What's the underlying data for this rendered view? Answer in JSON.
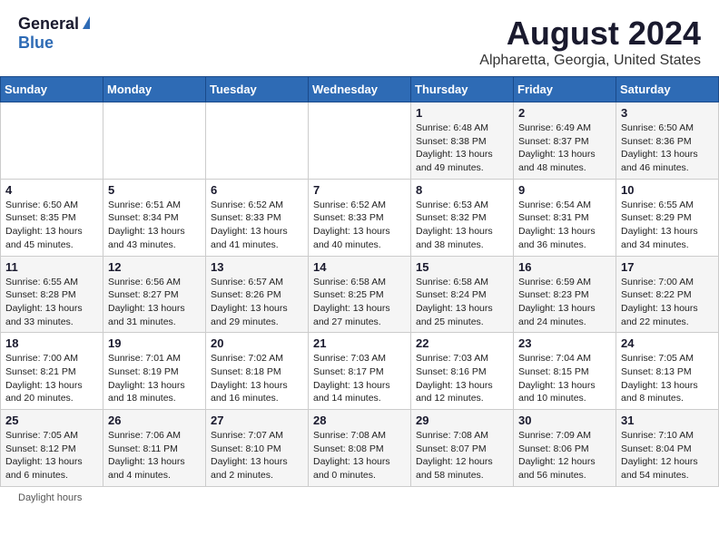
{
  "logo": {
    "general": "General",
    "blue": "Blue"
  },
  "title": "August 2024",
  "subtitle": "Alpharetta, Georgia, United States",
  "days_of_week": [
    "Sunday",
    "Monday",
    "Tuesday",
    "Wednesday",
    "Thursday",
    "Friday",
    "Saturday"
  ],
  "footer": {
    "daylight_label": "Daylight hours"
  },
  "weeks": [
    [
      {
        "day": "",
        "sunrise": "",
        "sunset": "",
        "daylight": "",
        "empty": true
      },
      {
        "day": "",
        "sunrise": "",
        "sunset": "",
        "daylight": "",
        "empty": true
      },
      {
        "day": "",
        "sunrise": "",
        "sunset": "",
        "daylight": "",
        "empty": true
      },
      {
        "day": "",
        "sunrise": "",
        "sunset": "",
        "daylight": "",
        "empty": true
      },
      {
        "day": "1",
        "sunrise": "Sunrise: 6:48 AM",
        "sunset": "Sunset: 8:38 PM",
        "daylight": "Daylight: 13 hours and 49 minutes.",
        "empty": false
      },
      {
        "day": "2",
        "sunrise": "Sunrise: 6:49 AM",
        "sunset": "Sunset: 8:37 PM",
        "daylight": "Daylight: 13 hours and 48 minutes.",
        "empty": false
      },
      {
        "day": "3",
        "sunrise": "Sunrise: 6:50 AM",
        "sunset": "Sunset: 8:36 PM",
        "daylight": "Daylight: 13 hours and 46 minutes.",
        "empty": false
      }
    ],
    [
      {
        "day": "4",
        "sunrise": "Sunrise: 6:50 AM",
        "sunset": "Sunset: 8:35 PM",
        "daylight": "Daylight: 13 hours and 45 minutes.",
        "empty": false
      },
      {
        "day": "5",
        "sunrise": "Sunrise: 6:51 AM",
        "sunset": "Sunset: 8:34 PM",
        "daylight": "Daylight: 13 hours and 43 minutes.",
        "empty": false
      },
      {
        "day": "6",
        "sunrise": "Sunrise: 6:52 AM",
        "sunset": "Sunset: 8:33 PM",
        "daylight": "Daylight: 13 hours and 41 minutes.",
        "empty": false
      },
      {
        "day": "7",
        "sunrise": "Sunrise: 6:52 AM",
        "sunset": "Sunset: 8:33 PM",
        "daylight": "Daylight: 13 hours and 40 minutes.",
        "empty": false
      },
      {
        "day": "8",
        "sunrise": "Sunrise: 6:53 AM",
        "sunset": "Sunset: 8:32 PM",
        "daylight": "Daylight: 13 hours and 38 minutes.",
        "empty": false
      },
      {
        "day": "9",
        "sunrise": "Sunrise: 6:54 AM",
        "sunset": "Sunset: 8:31 PM",
        "daylight": "Daylight: 13 hours and 36 minutes.",
        "empty": false
      },
      {
        "day": "10",
        "sunrise": "Sunrise: 6:55 AM",
        "sunset": "Sunset: 8:29 PM",
        "daylight": "Daylight: 13 hours and 34 minutes.",
        "empty": false
      }
    ],
    [
      {
        "day": "11",
        "sunrise": "Sunrise: 6:55 AM",
        "sunset": "Sunset: 8:28 PM",
        "daylight": "Daylight: 13 hours and 33 minutes.",
        "empty": false
      },
      {
        "day": "12",
        "sunrise": "Sunrise: 6:56 AM",
        "sunset": "Sunset: 8:27 PM",
        "daylight": "Daylight: 13 hours and 31 minutes.",
        "empty": false
      },
      {
        "day": "13",
        "sunrise": "Sunrise: 6:57 AM",
        "sunset": "Sunset: 8:26 PM",
        "daylight": "Daylight: 13 hours and 29 minutes.",
        "empty": false
      },
      {
        "day": "14",
        "sunrise": "Sunrise: 6:58 AM",
        "sunset": "Sunset: 8:25 PM",
        "daylight": "Daylight: 13 hours and 27 minutes.",
        "empty": false
      },
      {
        "day": "15",
        "sunrise": "Sunrise: 6:58 AM",
        "sunset": "Sunset: 8:24 PM",
        "daylight": "Daylight: 13 hours and 25 minutes.",
        "empty": false
      },
      {
        "day": "16",
        "sunrise": "Sunrise: 6:59 AM",
        "sunset": "Sunset: 8:23 PM",
        "daylight": "Daylight: 13 hours and 24 minutes.",
        "empty": false
      },
      {
        "day": "17",
        "sunrise": "Sunrise: 7:00 AM",
        "sunset": "Sunset: 8:22 PM",
        "daylight": "Daylight: 13 hours and 22 minutes.",
        "empty": false
      }
    ],
    [
      {
        "day": "18",
        "sunrise": "Sunrise: 7:00 AM",
        "sunset": "Sunset: 8:21 PM",
        "daylight": "Daylight: 13 hours and 20 minutes.",
        "empty": false
      },
      {
        "day": "19",
        "sunrise": "Sunrise: 7:01 AM",
        "sunset": "Sunset: 8:19 PM",
        "daylight": "Daylight: 13 hours and 18 minutes.",
        "empty": false
      },
      {
        "day": "20",
        "sunrise": "Sunrise: 7:02 AM",
        "sunset": "Sunset: 8:18 PM",
        "daylight": "Daylight: 13 hours and 16 minutes.",
        "empty": false
      },
      {
        "day": "21",
        "sunrise": "Sunrise: 7:03 AM",
        "sunset": "Sunset: 8:17 PM",
        "daylight": "Daylight: 13 hours and 14 minutes.",
        "empty": false
      },
      {
        "day": "22",
        "sunrise": "Sunrise: 7:03 AM",
        "sunset": "Sunset: 8:16 PM",
        "daylight": "Daylight: 13 hours and 12 minutes.",
        "empty": false
      },
      {
        "day": "23",
        "sunrise": "Sunrise: 7:04 AM",
        "sunset": "Sunset: 8:15 PM",
        "daylight": "Daylight: 13 hours and 10 minutes.",
        "empty": false
      },
      {
        "day": "24",
        "sunrise": "Sunrise: 7:05 AM",
        "sunset": "Sunset: 8:13 PM",
        "daylight": "Daylight: 13 hours and 8 minutes.",
        "empty": false
      }
    ],
    [
      {
        "day": "25",
        "sunrise": "Sunrise: 7:05 AM",
        "sunset": "Sunset: 8:12 PM",
        "daylight": "Daylight: 13 hours and 6 minutes.",
        "empty": false
      },
      {
        "day": "26",
        "sunrise": "Sunrise: 7:06 AM",
        "sunset": "Sunset: 8:11 PM",
        "daylight": "Daylight: 13 hours and 4 minutes.",
        "empty": false
      },
      {
        "day": "27",
        "sunrise": "Sunrise: 7:07 AM",
        "sunset": "Sunset: 8:10 PM",
        "daylight": "Daylight: 13 hours and 2 minutes.",
        "empty": false
      },
      {
        "day": "28",
        "sunrise": "Sunrise: 7:08 AM",
        "sunset": "Sunset: 8:08 PM",
        "daylight": "Daylight: 13 hours and 0 minutes.",
        "empty": false
      },
      {
        "day": "29",
        "sunrise": "Sunrise: 7:08 AM",
        "sunset": "Sunset: 8:07 PM",
        "daylight": "Daylight: 12 hours and 58 minutes.",
        "empty": false
      },
      {
        "day": "30",
        "sunrise": "Sunrise: 7:09 AM",
        "sunset": "Sunset: 8:06 PM",
        "daylight": "Daylight: 12 hours and 56 minutes.",
        "empty": false
      },
      {
        "day": "31",
        "sunrise": "Sunrise: 7:10 AM",
        "sunset": "Sunset: 8:04 PM",
        "daylight": "Daylight: 12 hours and 54 minutes.",
        "empty": false
      }
    ]
  ]
}
